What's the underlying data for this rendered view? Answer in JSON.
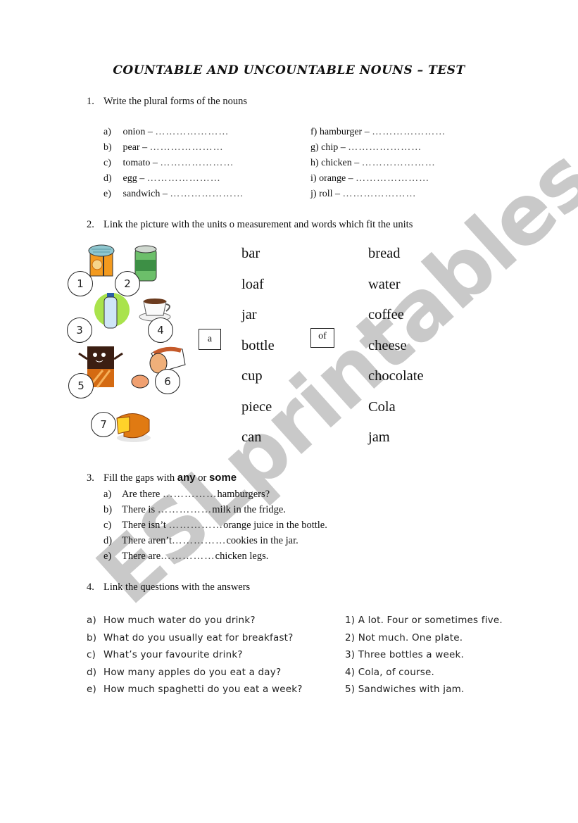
{
  "watermark": "ESLprintables.com",
  "title": "COUNTABLE AND UNCOUNTABLE NOUNS – TEST",
  "q1": {
    "number": "1.",
    "instruction": "Write the plural forms of the nouns",
    "left": [
      {
        "label": "a)",
        "word": "onion –",
        "blank": "…………………"
      },
      {
        "label": "b)",
        "word": "pear –",
        "blank": "…………………"
      },
      {
        "label": "c)",
        "word": "tomato –",
        "blank": "…………………"
      },
      {
        "label": "d)",
        "word": "egg –",
        "blank": "…………………"
      },
      {
        "label": "e)",
        "word": "sandwich –",
        "blank": "…………………"
      }
    ],
    "right": [
      {
        "label": "f)",
        "word": "hamburger –",
        "blank": "…………………"
      },
      {
        "label": "g)",
        "word": "chip –",
        "blank": "…………………"
      },
      {
        "label": "h)",
        "word": "chicken –",
        "blank": "…………………"
      },
      {
        "label": "i)",
        "word": "orange –",
        "blank": "…………………"
      },
      {
        "label": "j)",
        "word": "roll –",
        "blank": "…………………"
      }
    ]
  },
  "q2": {
    "number": "2.",
    "instruction": "Link the picture with the units o measurement and words which fit the units",
    "pictures": [
      {
        "number": "1",
        "icon": "jam-jar-icon"
      },
      {
        "number": "2",
        "icon": "soda-can-icon"
      },
      {
        "number": "3",
        "icon": "water-bottle-icon"
      },
      {
        "number": "4",
        "icon": "coffee-cup-icon"
      },
      {
        "number": "5",
        "icon": "chocolate-bar-icon"
      },
      {
        "number": "6",
        "icon": "bread-loaf-icon"
      },
      {
        "number": "7",
        "icon": "cheese-wheel-icon"
      }
    ],
    "article_box": "a",
    "of_box": "of",
    "units": [
      "bar",
      "loaf",
      "jar",
      "bottle",
      "cup",
      "piece",
      "can"
    ],
    "foods": [
      "bread",
      "water",
      "coffee",
      "cheese",
      "chocolate",
      "Cola",
      "jam"
    ]
  },
  "q3": {
    "number": "3.",
    "instruction_prefix": "Fill the gaps with",
    "word_any": "any",
    "word_or": "or",
    "word_some": "some",
    "items": [
      {
        "label": "a)",
        "before": "Are there",
        "blank": "……………",
        "after": "hamburgers?"
      },
      {
        "label": "b)",
        "before": "There is",
        "blank": "……………",
        "after": "milk in the fridge."
      },
      {
        "label": "c)",
        "before": "There isn’t",
        "blank": "……………",
        "after": "orange juice in the bottle."
      },
      {
        "label": "d)",
        "before": "There aren’t",
        "blank": "……………",
        "after": "cookies in the jar."
      },
      {
        "label": "e)",
        "before": "There are",
        "blank": "……………",
        "after": "chicken legs."
      }
    ]
  },
  "q4": {
    "number": "4.",
    "instruction": "Link the questions with the answers",
    "questions": [
      {
        "label": "a)",
        "text": "How much water do you drink?"
      },
      {
        "label": "b)",
        "text": "What do you usually eat for breakfast?"
      },
      {
        "label": "c)",
        "text": "What’s your favourite drink?"
      },
      {
        "label": "d)",
        "text": "How many apples do you eat a day?"
      },
      {
        "label": "e)",
        "text": "How much spaghetti do you eat a week?"
      }
    ],
    "answers": [
      "1) A lot. Four or sometimes five.",
      "2) Not much. One plate.",
      "3) Three bottles a week.",
      "4) Cola, of course.",
      "5) Sandwiches with jam."
    ]
  }
}
